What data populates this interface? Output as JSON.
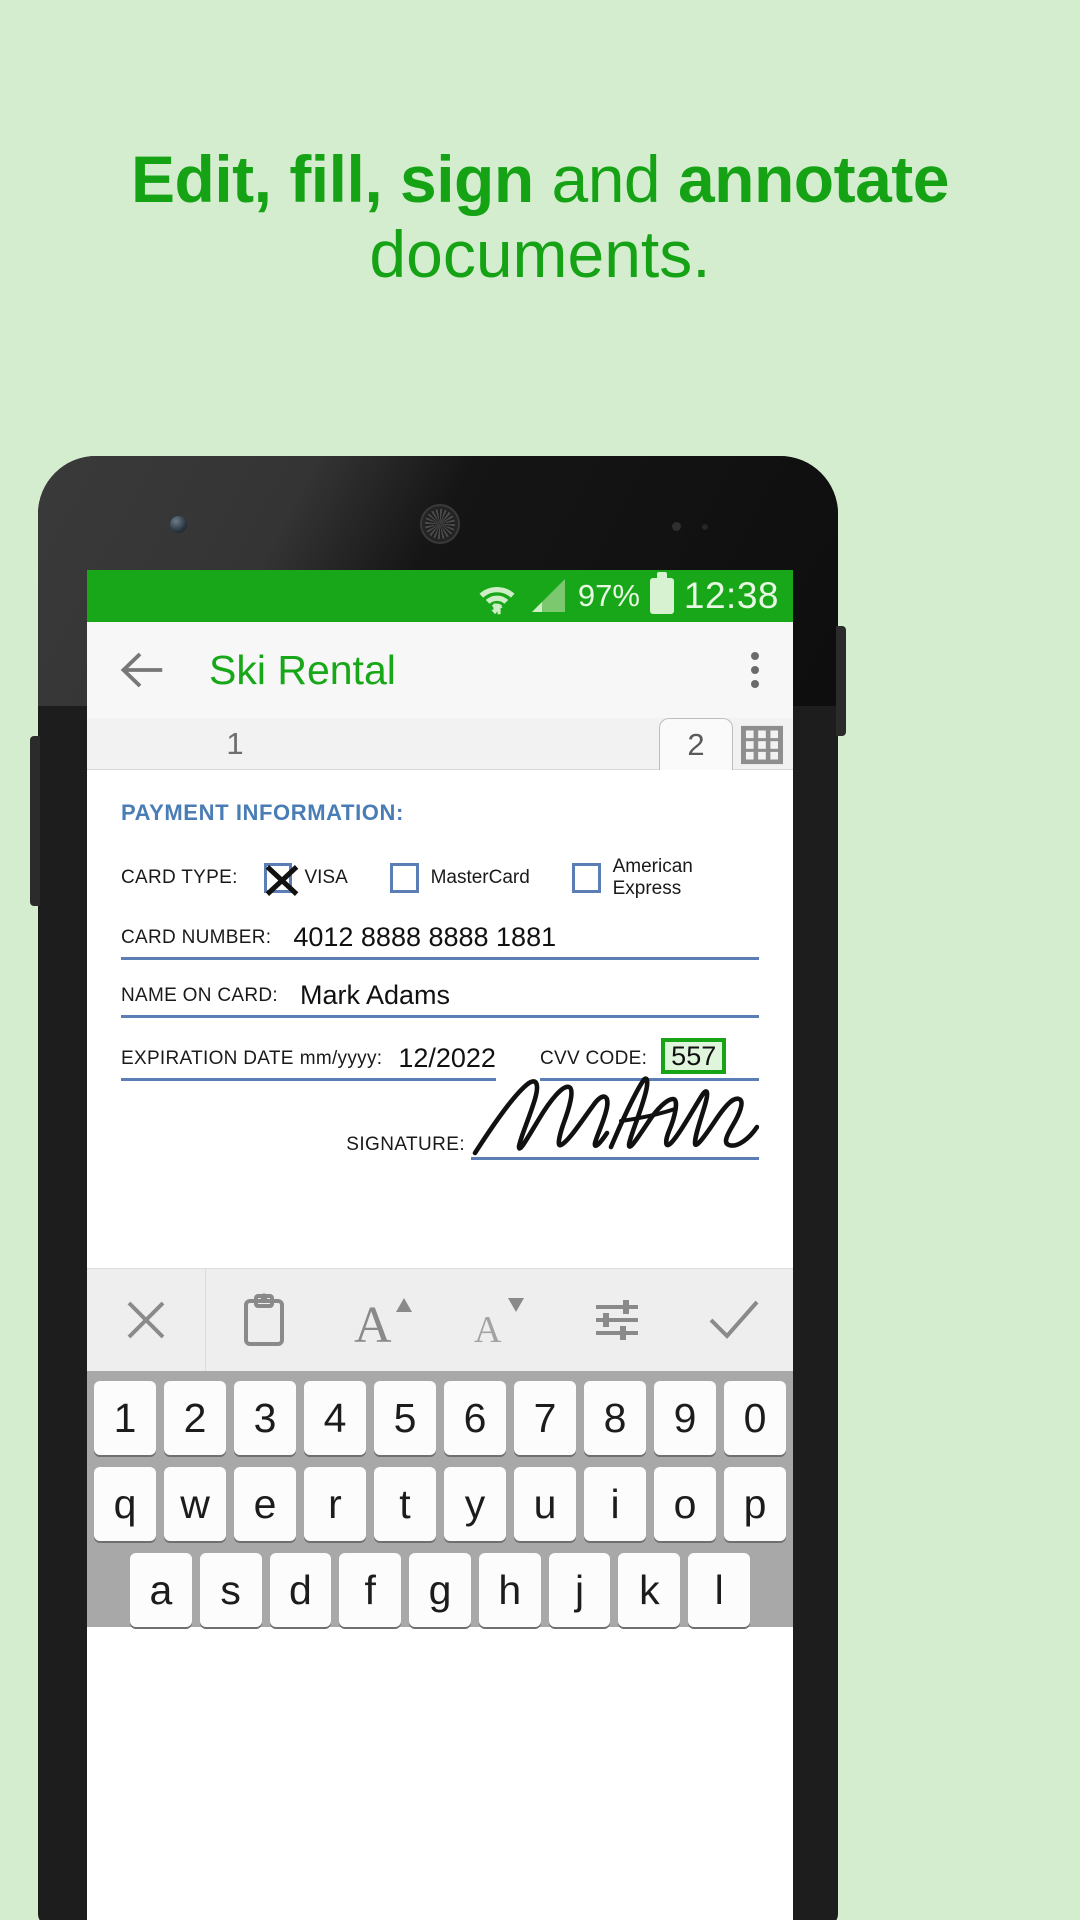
{
  "promo": {
    "line1_bold_a": "Edit, fill, sign",
    "line1_regular": " and ",
    "line1_bold_b": "annotate",
    "line2": "documents."
  },
  "colors": {
    "brand_green": "#18a718",
    "headline_green": "#15a215",
    "page_background": "#d4edcf",
    "form_blue": "#4a7db5",
    "field_rule_blue": "#5b7fb5",
    "active_field_green": "#17a517",
    "active_field_fill": "#dff5dc"
  },
  "statusbar": {
    "wifi_icon": "wifi-icon",
    "signal_icon": "cell-signal-icon",
    "battery_percent": "97%",
    "battery_icon": "battery-full-icon",
    "time": "12:38"
  },
  "toolbar": {
    "back_icon": "back-arrow-icon",
    "title": "Ski Rental",
    "overflow_icon": "overflow-menu-icon"
  },
  "tabs": {
    "items": [
      {
        "label": "1",
        "selected": false
      },
      {
        "label": "2",
        "selected": true
      }
    ],
    "grid_icon": "grid-view-icon"
  },
  "document": {
    "section_heading": "PAYMENT INFORMATION:",
    "card_type": {
      "label": "CARD TYPE:",
      "options": [
        {
          "label": "VISA",
          "checked": true
        },
        {
          "label": "MasterCard",
          "checked": false
        },
        {
          "label": "American Express",
          "checked": false
        }
      ]
    },
    "card_number": {
      "label": "CARD NUMBER:",
      "value": "4012 8888 8888 1881"
    },
    "name_on_card": {
      "label": "NAME ON CARD:",
      "value": "Mark Adams"
    },
    "expiration": {
      "label": "EXPIRATION DATE",
      "label_small": "mm/yyyy:",
      "value": "12/2022"
    },
    "cvv": {
      "label": "CVV CODE:",
      "value": "557",
      "active": true
    },
    "signature": {
      "label": "SIGNATURE:",
      "value": "MarkAdams"
    }
  },
  "edit_toolbar": {
    "items": [
      {
        "name": "close-icon",
        "label": "Close"
      },
      {
        "name": "clipboard-icon",
        "label": "Paste"
      },
      {
        "name": "increase-font-size-icon",
        "label": "Increase font size"
      },
      {
        "name": "decrease-font-size-icon",
        "label": "Decrease font size"
      },
      {
        "name": "adjust-settings-icon",
        "label": "Properties"
      },
      {
        "name": "checkmark-icon",
        "label": "Done"
      }
    ]
  },
  "keyboard": {
    "row_numbers": [
      "1",
      "2",
      "3",
      "4",
      "5",
      "6",
      "7",
      "8",
      "9",
      "0"
    ],
    "row_top": [
      "q",
      "w",
      "e",
      "r",
      "t",
      "y",
      "u",
      "i",
      "o",
      "p"
    ],
    "row_home": [
      "a",
      "s",
      "d",
      "f",
      "g",
      "h",
      "j",
      "k",
      "l"
    ]
  }
}
